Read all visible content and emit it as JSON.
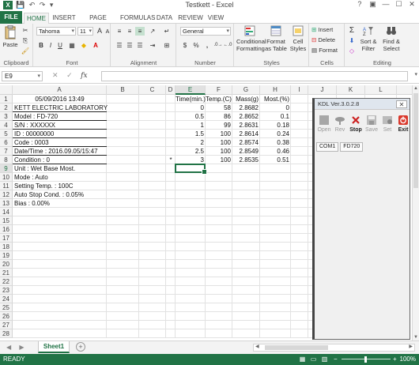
{
  "window": {
    "title": "Testkett - Excel",
    "app_icon": "X",
    "qat": [
      "💾",
      "↶",
      "↷",
      "▾"
    ],
    "controls": [
      "?",
      "▣",
      "—",
      "☐",
      "✕"
    ]
  },
  "tabs": [
    "FILE",
    "HOME",
    "INSERT",
    "PAGE LAYOUT",
    "FORMULAS",
    "DATA",
    "REVIEW",
    "VIEW"
  ],
  "ribbon": {
    "clipboard": {
      "label": "Clipboard",
      "paste": "Paste"
    },
    "font": {
      "label": "Font",
      "name": "Tahoma",
      "size": "11",
      "bold": "B",
      "italic": "I",
      "underline": "U",
      "grow": "A",
      "shrink": "A"
    },
    "alignment": {
      "label": "Alignment"
    },
    "number": {
      "label": "Number",
      "format": "General",
      "currency": "$",
      "percent": "%",
      "comma": ","
    },
    "styles": {
      "label": "Styles",
      "conditional": "Conditional Formatting",
      "format_table": "Format as Table",
      "cell_styles": "Cell Styles"
    },
    "cells": {
      "label": "Cells",
      "insert": "Insert",
      "delete": "Delete",
      "format": "Format"
    },
    "editing": {
      "label": "Editing",
      "sum": "Σ",
      "sort": "Sort & Filter",
      "find": "Find & Select"
    }
  },
  "formula_bar": {
    "name_box": "E9",
    "cancel": "✕",
    "enter": "✓",
    "fx": "fx",
    "value": ""
  },
  "columns": [
    "A",
    "B",
    "C",
    "D",
    "E",
    "F",
    "G",
    "H",
    "I",
    "J",
    "K",
    "L"
  ],
  "rows": [
    "1",
    "2",
    "3",
    "4",
    "5",
    "6",
    "7",
    "8",
    "9",
    "10",
    "11",
    "12",
    "13",
    "14",
    "15",
    "16",
    "17",
    "18",
    "19",
    "20",
    "21",
    "22",
    "23",
    "24",
    "25",
    "26",
    "27",
    "28"
  ],
  "sheet": {
    "A1": "05/09/2016 13:49",
    "A2": "KETT ELECTRIC LABORATORY",
    "A3": "Model : FD-720",
    "A4": "S/N :  XXXXXX",
    "A5": "ID : 00000000",
    "A6": "Code : 0003",
    "A7": "Date/Time : 2016.09.05/15:47",
    "A8": "Condition : 0",
    "A9": "Unit : Wet Base Most.",
    "A10": "Mode : Auto",
    "A11": "Setting Temp. : 100C",
    "A12": "Auto Stop Cond. : 0.05%",
    "A13": "Bias : 0.00%",
    "D8": "*",
    "headers": [
      "Time(min.)",
      "Temp.(C)",
      "Mass(g)",
      "Most.(%)"
    ],
    "data": [
      [
        "0",
        "58",
        "2.8682",
        "0"
      ],
      [
        "0.5",
        "86",
        "2.8652",
        "0.1"
      ],
      [
        "1",
        "99",
        "2.8631",
        "0.18"
      ],
      [
        "1.5",
        "100",
        "2.8614",
        "0.24"
      ],
      [
        "2",
        "100",
        "2.8574",
        "0.38"
      ],
      [
        "2.5",
        "100",
        "2.8549",
        "0.46"
      ],
      [
        "3",
        "100",
        "2.8535",
        "0.51"
      ]
    ]
  },
  "kdl": {
    "title": "KDL Ver.3.0.2.8",
    "buttons": [
      "Open",
      "Rev",
      "Stop",
      "Save",
      "Set",
      "Exit"
    ],
    "port": "COM1",
    "model": "FD720"
  },
  "sheet_tabs": {
    "active": "Sheet1",
    "nav": [
      "◀",
      "▶"
    ],
    "add": "+"
  },
  "status": {
    "ready": "READY",
    "zoom": "100%",
    "minus": "−",
    "plus": "+"
  },
  "colors": {
    "excel_green": "#217346",
    "exit_red": "#d9382c",
    "stop_red": "#cc2222"
  }
}
